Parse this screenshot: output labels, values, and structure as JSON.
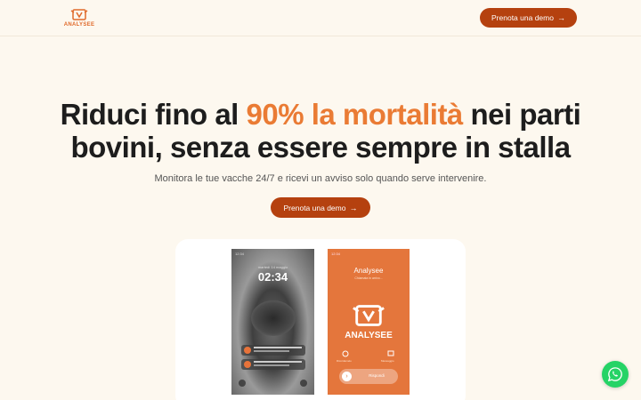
{
  "brand": {
    "logo_text": "ANALYSEE",
    "color": "#e06a2b"
  },
  "header": {
    "cta_label": "Prenota una demo",
    "cta_arrow": "→"
  },
  "hero": {
    "title_part1": "Riduci fino al ",
    "title_accent": "90% la mortalità",
    "title_part2": " nei parti bovini, senza essere sempre in stalla",
    "subtitle": "Monitora le tue vacche 24/7 e ricevi un avviso solo quando serve intervenire.",
    "cta_label": "Prenota una demo",
    "cta_arrow": "→",
    "accent_color": "#ea7b34"
  },
  "phone_lock": {
    "status": "12:34",
    "date": "martedì 14 maggio",
    "time": "02:34"
  },
  "phone_app": {
    "status": "12:34",
    "app_name": "Analysee",
    "app_sub": "Chiamata in arrivo...",
    "logo_text": "ANALYSEE",
    "slide_label": "Rispondi",
    "left_label": "Ricordamelo",
    "right_label": "Messaggio"
  },
  "whatsapp": {
    "icon": "whatsapp-icon",
    "color": "#25d366"
  }
}
